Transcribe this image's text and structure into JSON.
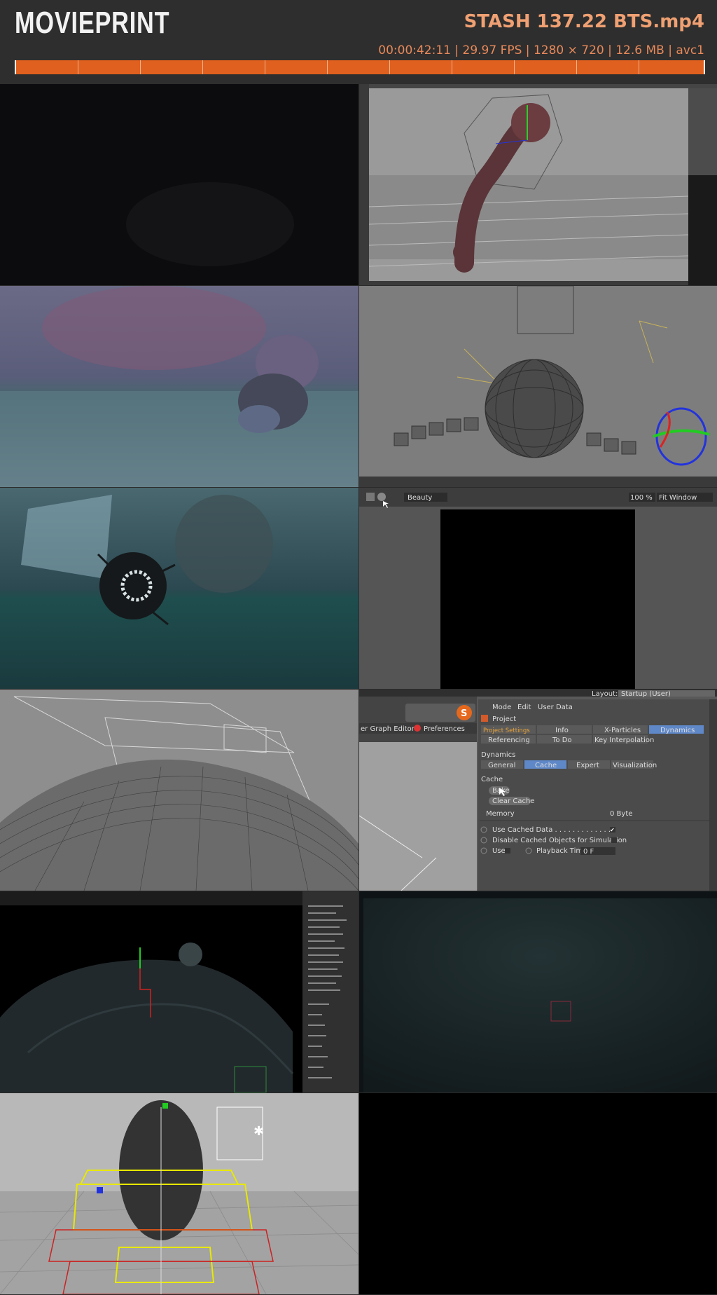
{
  "app": {
    "logo": "MOVIEPRINT"
  },
  "file": {
    "name": "STASH 137.22 BTS.mp4",
    "meta": "00:00:42:11 | 29.97 FPS | 1280 × 720 | 12.6 MB | avc1"
  },
  "timeline": {
    "accent": "#e0601f",
    "segments": 11
  },
  "frames": [
    {
      "id": "frame-1",
      "desc": "dark frame"
    },
    {
      "id": "frame-2",
      "desc": "3D viewport bent tube"
    },
    {
      "id": "frame-3",
      "desc": "render crystal rock"
    },
    {
      "id": "frame-4",
      "desc": "wireframe sphere chain"
    },
    {
      "id": "frame-5",
      "desc": "render spiked sphere teal"
    },
    {
      "id": "frame-6",
      "desc": "picture viewer black"
    },
    {
      "id": "frame-7",
      "desc": "wireframe terrain"
    },
    {
      "id": "frame-8",
      "desc": "project settings panel"
    },
    {
      "id": "frame-9",
      "desc": "viewport terrain with object browser"
    },
    {
      "id": "frame-10",
      "desc": "dark teal frame"
    },
    {
      "id": "frame-11",
      "desc": "rig cages"
    },
    {
      "id": "frame-12",
      "desc": "empty"
    }
  ],
  "viewer": {
    "render_setting": "Beauty",
    "zoom": "100 %",
    "fit": "Fit Window"
  },
  "settings_panel": {
    "layout_label": "Layout:",
    "layout_value": "Startup (User)",
    "menu": [
      "Mode",
      "Edit",
      "User Data"
    ],
    "object_title": "Project",
    "left_tabs": [
      "er Graph Editor",
      "Preferences"
    ],
    "tabs_row1": [
      "Project Settings",
      "Info",
      "X-Particles",
      "Dynamics"
    ],
    "tabs_row2": [
      "Referencing",
      "To Do",
      "Key Interpolation"
    ],
    "section_dynamics": "Dynamics",
    "subtabs": [
      "General",
      "Cache",
      "Expert",
      "Visualization"
    ],
    "section_cache": "Cache",
    "bake_button": "Bake",
    "clear_cache_button": "Clear Cache",
    "memory_label": "Memory",
    "memory_value": "0 Byte",
    "opt_use_cached": "Use Cached Data . . . . . . . . . . . . .",
    "opt_disable_cached": "Disable Cached Objects for Simulation",
    "opt_use": "Use",
    "playback_label": "Playback Time",
    "playback_value": "0 F"
  }
}
